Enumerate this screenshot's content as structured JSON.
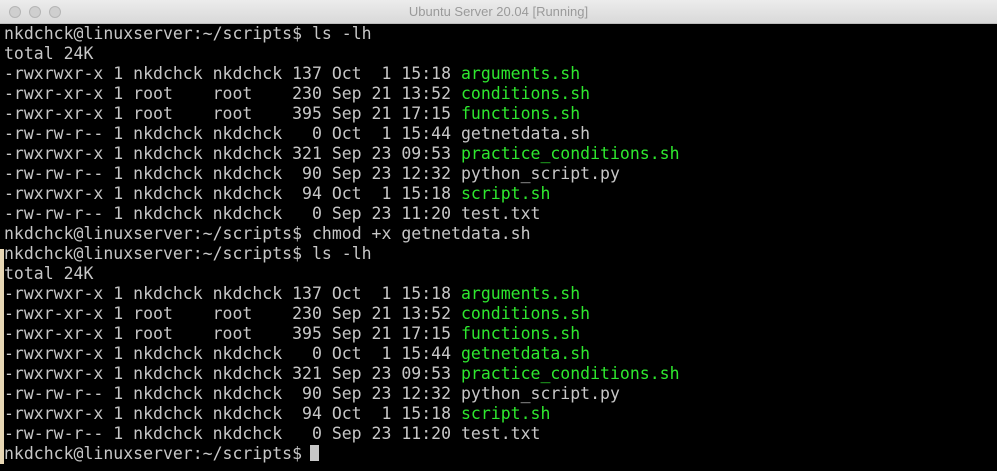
{
  "window": {
    "title": "Ubuntu Server 20.04 [Running]"
  },
  "colors": {
    "background": "#000000",
    "text": "#c7c7c7",
    "executable": "#2ee82e"
  },
  "terminal": {
    "prompt": "nkdchck@linuxserver:~/scripts$",
    "commands": [
      "ls -lh",
      "chmod +x getnetdata.sh",
      "ls -lh"
    ],
    "listing_before": {
      "total": "total 24K",
      "rows": [
        {
          "meta": "-rwxrwxr-x 1 nkdchck nkdchck 137 Oct  1 15:18",
          "name": "arguments.sh",
          "exec": true
        },
        {
          "meta": "-rwxr-xr-x 1 root    root    230 Sep 21 13:52",
          "name": "conditions.sh",
          "exec": true
        },
        {
          "meta": "-rwxr-xr-x 1 root    root    395 Sep 21 17:15",
          "name": "functions.sh",
          "exec": true
        },
        {
          "meta": "-rw-rw-r-- 1 nkdchck nkdchck   0 Oct  1 15:44",
          "name": "getnetdata.sh",
          "exec": false
        },
        {
          "meta": "-rwxrwxr-x 1 nkdchck nkdchck 321 Sep 23 09:53",
          "name": "practice_conditions.sh",
          "exec": true
        },
        {
          "meta": "-rw-rw-r-- 1 nkdchck nkdchck  90 Sep 23 12:32",
          "name": "python_script.py",
          "exec": false
        },
        {
          "meta": "-rwxrwxr-x 1 nkdchck nkdchck  94 Oct  1 15:18",
          "name": "script.sh",
          "exec": true
        },
        {
          "meta": "-rw-rw-r-- 1 nkdchck nkdchck   0 Sep 23 11:20",
          "name": "test.txt",
          "exec": false
        }
      ]
    },
    "listing_after": {
      "total": "total 24K",
      "rows": [
        {
          "meta": "-rwxrwxr-x 1 nkdchck nkdchck 137 Oct  1 15:18",
          "name": "arguments.sh",
          "exec": true
        },
        {
          "meta": "-rwxr-xr-x 1 root    root    230 Sep 21 13:52",
          "name": "conditions.sh",
          "exec": true
        },
        {
          "meta": "-rwxr-xr-x 1 root    root    395 Sep 21 17:15",
          "name": "functions.sh",
          "exec": true
        },
        {
          "meta": "-rwxrwxr-x 1 nkdchck nkdchck   0 Oct  1 15:44",
          "name": "getnetdata.sh",
          "exec": true
        },
        {
          "meta": "-rwxrwxr-x 1 nkdchck nkdchck 321 Sep 23 09:53",
          "name": "practice_conditions.sh",
          "exec": true
        },
        {
          "meta": "-rw-rw-r-- 1 nkdchck nkdchck  90 Sep 23 12:32",
          "name": "python_script.py",
          "exec": false
        },
        {
          "meta": "-rwxrwxr-x 1 nkdchck nkdchck  94 Oct  1 15:18",
          "name": "script.sh",
          "exec": true
        },
        {
          "meta": "-rw-rw-r-- 1 nkdchck nkdchck   0 Sep 23 11:20",
          "name": "test.txt",
          "exec": false
        }
      ]
    }
  }
}
